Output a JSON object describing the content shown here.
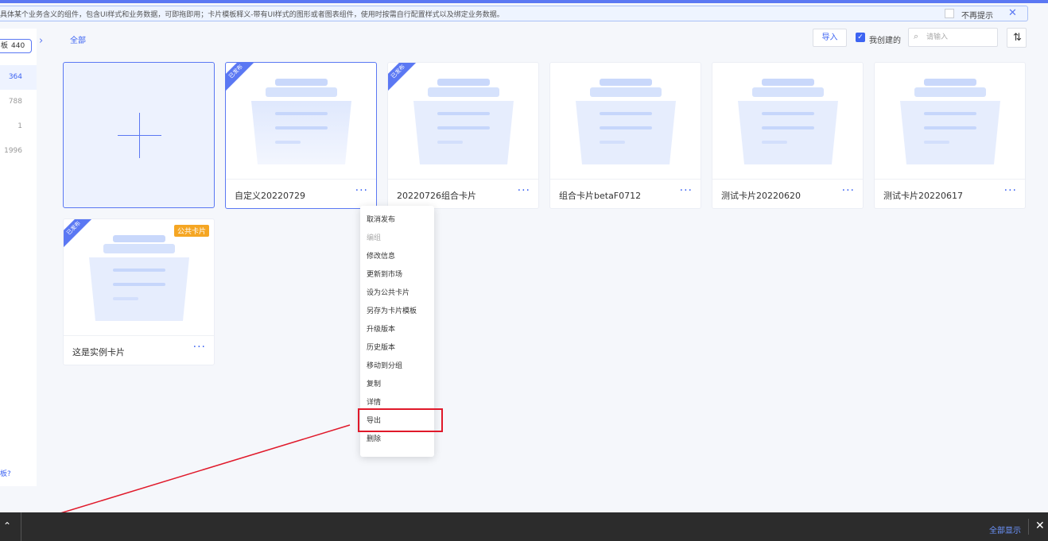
{
  "notice": {
    "text": "具体某个业务含义的组件，包含UI样式和业务数据，可即拖即用；卡片模板释义-带有UI样式的图形或者图表组件，使用时按需自行配置样式以及绑定业务数据。",
    "dont_show_label": "不再提示",
    "close_icon": "✕"
  },
  "sidebar": {
    "tag_label": "板",
    "tag_count": "440",
    "expand_icon": "›",
    "counts": [
      "364",
      "788",
      "1",
      "1996"
    ],
    "footer_link": "板?"
  },
  "toolbar": {
    "tab_all": "全部",
    "import_label": "导入",
    "mine_checked": true,
    "mine_label": "我创建的",
    "search_placeholder": "请输入",
    "search_icon": "⌕",
    "sort_icon": "⇅"
  },
  "cards": [
    {
      "name": "自定义20220729",
      "more": "···",
      "published": "已发布"
    },
    {
      "name": "20220726组合卡片",
      "more": "···",
      "published": "已发布"
    },
    {
      "name": "组合卡片betaF0712",
      "more": "···"
    },
    {
      "name": "测试卡片20220620",
      "more": "···"
    },
    {
      "name": "测试卡片20220617",
      "more": "···"
    },
    {
      "name": "这是实例卡片",
      "more": "···",
      "published": "已发布",
      "badge": "公共卡片"
    }
  ],
  "context_menu": {
    "items": [
      "取消发布",
      "编组",
      "修改信息",
      "更新到市场",
      "设为公共卡片",
      "另存为卡片模板",
      "升级版本",
      "历史版本",
      "移动到分组",
      "复制",
      "详情",
      "导出",
      "删除"
    ],
    "disabled_index": 1,
    "highlighted_item": "导出"
  },
  "bottom_bar": {
    "collapse_icon": "⌃",
    "show_all_label": "全部显示",
    "close_icon": "✕"
  },
  "colors": {
    "accent": "#3d64f2",
    "annotation": "#e0192a",
    "badge": "#f5a623"
  }
}
